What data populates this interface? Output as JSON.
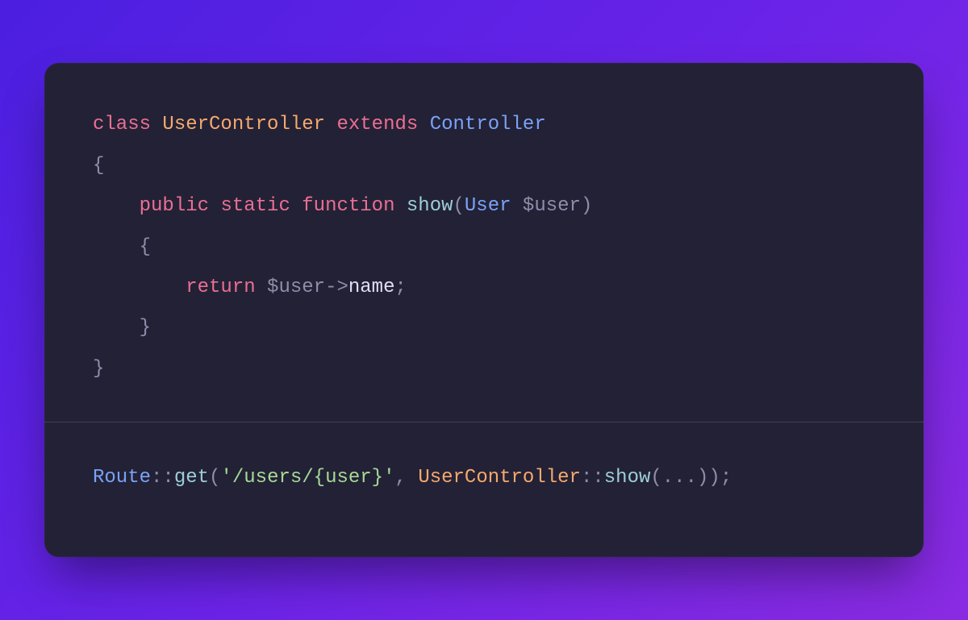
{
  "code": {
    "top": {
      "l1": {
        "kw_class": "class",
        "name": "UserController",
        "kw_extends": "extends",
        "base": "Controller"
      },
      "l2": {
        "brace_open": "{"
      },
      "l3": {
        "indent": "    ",
        "kw_public": "public",
        "kw_static": "static",
        "kw_function": "function",
        "fn": "show",
        "paren_open": "(",
        "type": "User",
        "var": "$user",
        "paren_close": ")"
      },
      "l4": {
        "indent": "    ",
        "brace_open": "{"
      },
      "l5": {
        "indent": "        ",
        "kw_return": "return",
        "var": "$user",
        "arrow": "->",
        "prop": "name",
        "semi": ";"
      },
      "l6": {
        "indent": "    ",
        "brace_close": "}"
      },
      "l7": {
        "brace_close": "}"
      }
    },
    "bottom": {
      "route_cls": "Route",
      "dcolon1": "::",
      "get_fn": "get",
      "paren_open": "(",
      "str": "'/users/{user}'",
      "comma": ", ",
      "ctrl_cls": "UserController",
      "dcolon2": "::",
      "show_fn": "show",
      "paren_open2": "(",
      "ellipsis": "...",
      "paren_close2": ")",
      "paren_close": ")",
      "semi": ";"
    }
  }
}
